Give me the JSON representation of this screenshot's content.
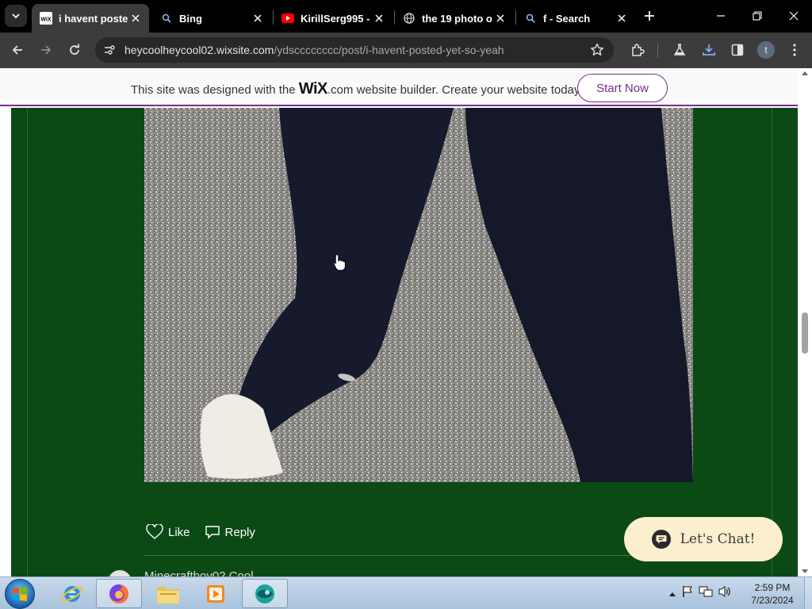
{
  "browser": {
    "tabs": [
      {
        "title": "i havent poste",
        "favicon": "wix-favicon",
        "active": true
      },
      {
        "title": "Bing",
        "favicon": "search-icon",
        "active": false
      },
      {
        "title": "KirillSerg995 -",
        "favicon": "youtube-icon",
        "active": false
      },
      {
        "title": "the 19 photo o",
        "favicon": "globe-icon",
        "active": false
      },
      {
        "title": "f - Search",
        "favicon": "search-icon",
        "active": false
      }
    ],
    "address": {
      "domain": "heycoolheycool02.wixsite.com",
      "path": "/ydscccccccc/post/i-havent-posted-yet-so-yeah"
    },
    "profile_initial": "t"
  },
  "wix_banner": {
    "text_before": "This site was designed with the ",
    "logo": "WiX",
    "text_after": ".com website builder. Create your website today.",
    "cta": "Start Now"
  },
  "post": {
    "like_label": "Like",
    "reply_label": "Reply",
    "commenter_name": "Minecraftboy02 Cool",
    "chat_label": "Let's Chat!"
  },
  "taskbar": {
    "time": "2:59 PM",
    "date": "7/23/2024"
  },
  "colors": {
    "page_bg": "#0b4a15",
    "wix_accent": "#7a2b8b",
    "chat_bg": "#fbefd0"
  }
}
